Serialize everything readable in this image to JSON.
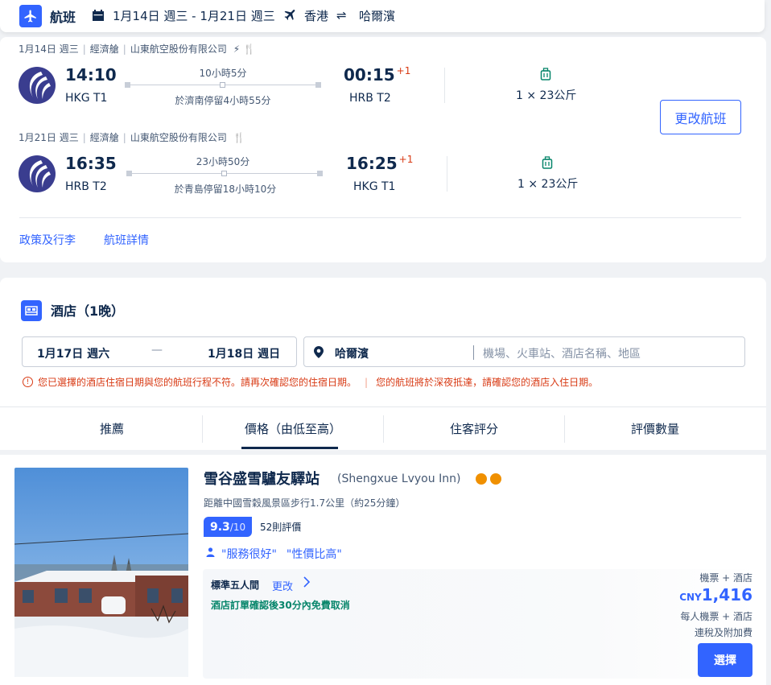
{
  "header": {
    "title": "航班",
    "dates": "1月14日 週三 - 1月21日 週三",
    "from": "香港",
    "swap_symbol": "⇌",
    "to": "哈爾濱"
  },
  "flights": [
    {
      "date": "1月14日 週三",
      "cabin": "經濟艙",
      "airline": "山東航空股份有限公司",
      "dep_time": "14:10",
      "dep_terminal": "HKG T1",
      "duration": "10小時5分",
      "stopover": "於濟南停留4小時55分",
      "arr_time": "00:15",
      "arr_plus": "+1",
      "arr_terminal": "HRB T2",
      "baggage": "1 × 23公斤"
    },
    {
      "date": "1月21日 週三",
      "cabin": "經濟艙",
      "airline": "山東航空股份有限公司",
      "dep_time": "16:35",
      "dep_terminal": "HRB T2",
      "duration": "23小時50分",
      "stopover": "於青島停留18小時10分",
      "arr_time": "16:25",
      "arr_plus": "+1",
      "arr_terminal": "HKG T1",
      "baggage": "1 × 23公斤"
    }
  ],
  "flight_actions": {
    "change": "更改航班",
    "policy": "政策及行李",
    "details": "航班詳情"
  },
  "hotel_search": {
    "title": "酒店（1晚）",
    "checkin": "1月17日 週六",
    "dash": "—",
    "checkout": "1月18日 週日",
    "city": "哈爾濱",
    "placeholder": "機場、火車站、酒店名稱、地區",
    "warning1": "您已選擇的酒店住宿日期與您的航班行程不符。請再次確認您的住宿日期。",
    "warning2": "您的航班將於深夜抵達，請確認您的酒店入住日期。"
  },
  "sort_tabs": [
    "推薦",
    "價格（由低至高）",
    "住客評分",
    "評價數量"
  ],
  "hotel": {
    "name": "雪谷盛雪驢友驛站",
    "name_en": "(Shengxue Lvyou Inn)",
    "distance": "距離中國雪穀風景區步行1.7公里（約25分鐘）",
    "score": "9.3",
    "score_max": "/10",
    "reviews": "52則評價",
    "tag1": "\"服務很好\"",
    "tag2": "\"性價比高\"",
    "room": "標準五人間",
    "room_change": "更改",
    "cancel_policy": "酒店訂單確認後30分內免費取消",
    "price_label": "機票 + 酒店",
    "currency": "CNY",
    "price": "1,416",
    "per_person": "每人機票 + 酒店",
    "tax_note": "連稅及附加費",
    "select": "選擇"
  },
  "colors": {
    "brand_blue": "#3264ff",
    "text_dark": "#0f294d",
    "warning_red": "#d83a14",
    "cancel_green": "#06856a",
    "star_orange": "#f09000"
  }
}
